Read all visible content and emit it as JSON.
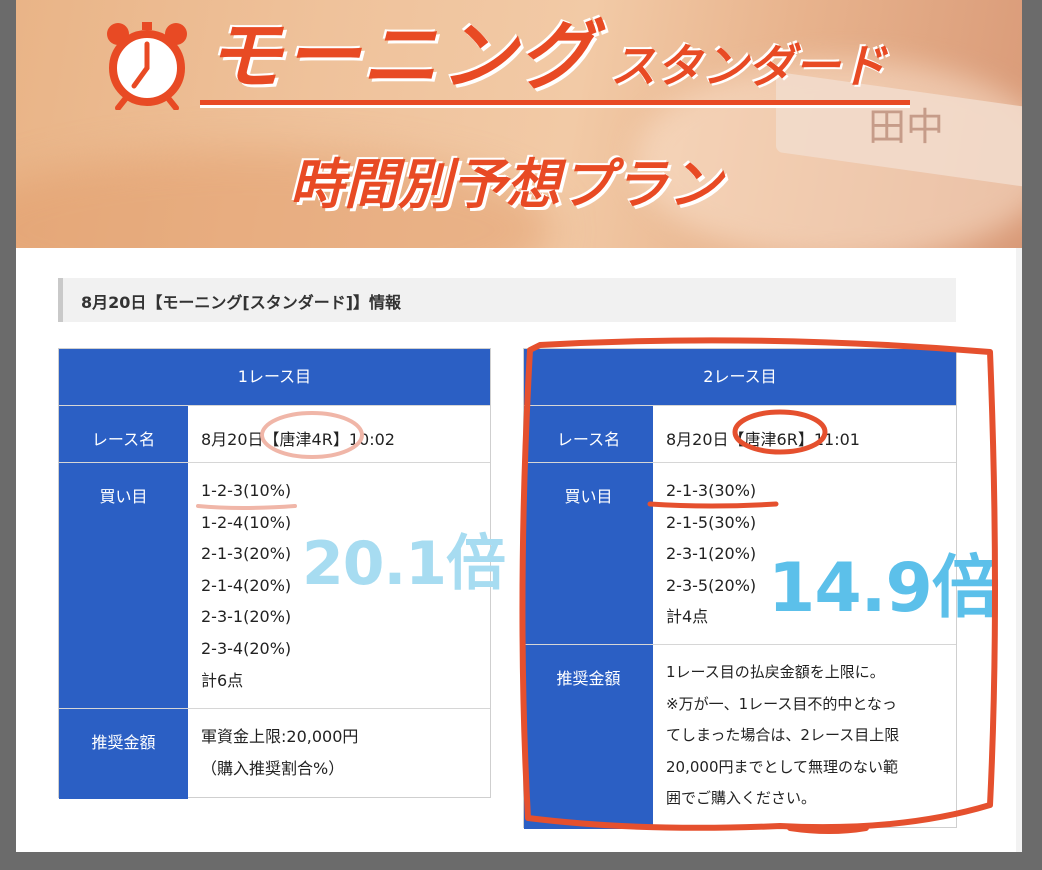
{
  "banner": {
    "title_main": "モーニング",
    "title_sub": "スタンダード",
    "title_plan": "時間別予想プラン",
    "boat_text": "田中"
  },
  "section": {
    "heading": "8月20日【モーニング[スタンダード]】情報"
  },
  "race1": {
    "header": "1レース目",
    "race_name_label": "レース名",
    "race_name_value": "8月20日【唐津4R】10:02",
    "bets_label": "買い目",
    "bets": [
      "1-2-3(10%)",
      "1-2-4(10%)",
      "2-1-3(20%)",
      "2-1-4(20%)",
      "2-3-1(20%)",
      "2-3-4(20%)"
    ],
    "bets_total": "計6点",
    "amount_label": "推奨金額",
    "amount_lines": [
      "軍資金上限:20,000円",
      "（購入推奨割合%）"
    ],
    "multiplier": "20.1倍"
  },
  "race2": {
    "header": "2レース目",
    "race_name_label": "レース名",
    "race_name_value": "8月20日【唐津6R】11:01",
    "bets_label": "買い目",
    "bets": [
      "2-1-3(30%)",
      "2-1-5(30%)",
      "2-3-1(20%)",
      "2-3-5(20%)"
    ],
    "bets_total": "計4点",
    "amount_label": "推奨金額",
    "amount_lines": [
      "1レース目の払戻金額を上限に。",
      "※万が一、1レース目不的中となっ",
      "てしまった場合は、2レース目上限",
      "20,000円までとして無理のない範",
      "囲でご購入ください。"
    ],
    "multiplier": "14.9倍"
  },
  "colors": {
    "brand_orange": "#e84a24",
    "table_blue": "#2b5fc4",
    "annotation_red": "#e5502e",
    "annotation_pink": "#f0b6a8",
    "multiplier_blue": "#5cc0ea"
  }
}
